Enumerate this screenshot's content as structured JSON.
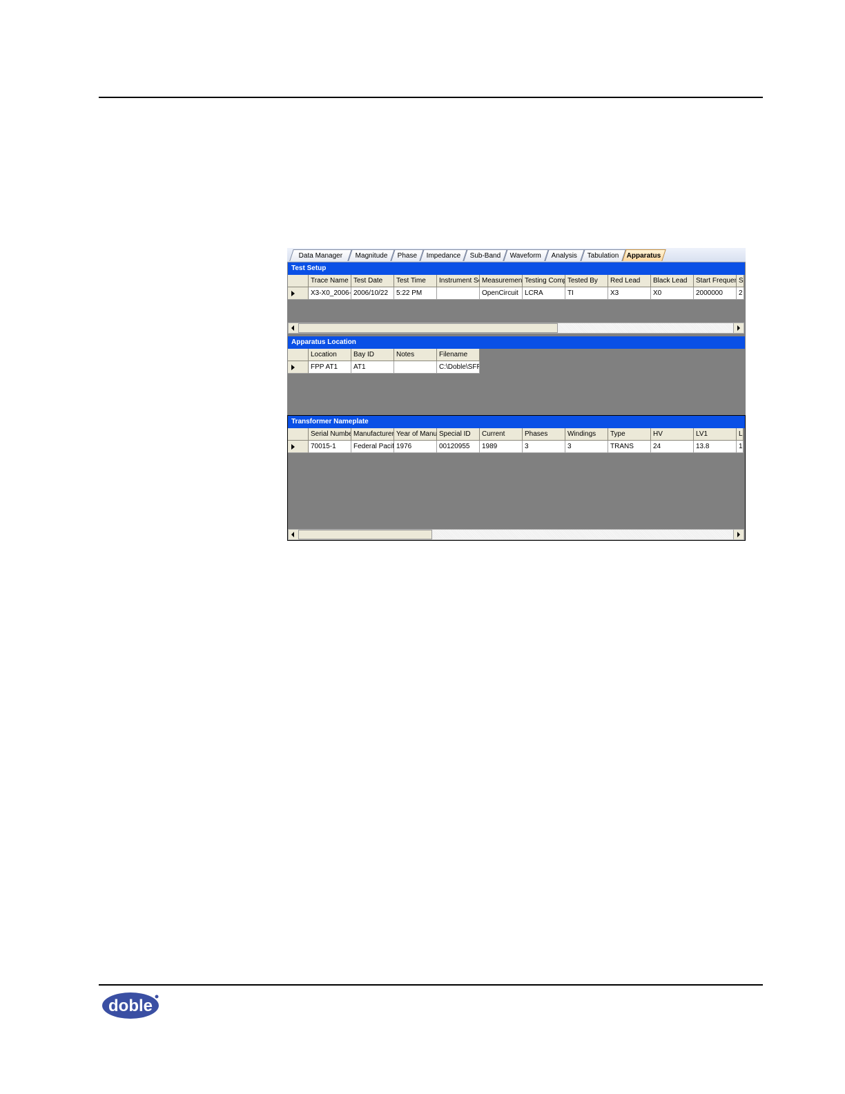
{
  "tabs": [
    "Data Manager",
    "Magnitude",
    "Phase",
    "Impedance",
    "Sub-Band",
    "Waveform",
    "Analysis",
    "Tabulation",
    "Apparatus"
  ],
  "active_tab": "Apparatus",
  "test_setup": {
    "title": "Test Setup",
    "columns": [
      "Trace Name",
      "Test Date",
      "Test Time",
      "Instrument Se",
      "Measurement",
      "Testing Comp",
      "Tested By",
      "Red Lead",
      "Black Lead",
      "Start Frequen",
      "S"
    ],
    "rows": [
      [
        "X3-X0_2006-",
        "2006/10/22",
        "5:22 PM",
        "",
        "OpenCircuit",
        "LCRA",
        "TI",
        "X3",
        "X0",
        "2000000",
        "2"
      ]
    ]
  },
  "apparatus_location": {
    "title": "Apparatus Location",
    "columns": [
      "Location",
      "Bay ID",
      "Notes",
      "Filename"
    ],
    "rows": [
      [
        "FPP AT1",
        "AT1",
        "",
        "C:\\Doble\\SFR"
      ]
    ]
  },
  "transformer_nameplate": {
    "title": "Transformer Nameplate",
    "columns": [
      "Serial Numbe",
      "Manufacturer",
      "Year of Manuf",
      "Special ID",
      "Current",
      "Phases",
      "Windings",
      "Type",
      "HV",
      "LV1",
      "L"
    ],
    "rows": [
      [
        "70015-1",
        "Federal Pacifi",
        "1976",
        "00120955",
        "1989",
        "3",
        "3",
        "TRANS",
        "24",
        "13.8",
        "1"
      ]
    ]
  },
  "colors": {
    "section_header": "#0a50e6",
    "grid_background": "#808080",
    "active_tab": "#fbd7a1"
  },
  "logo_text": "doble"
}
